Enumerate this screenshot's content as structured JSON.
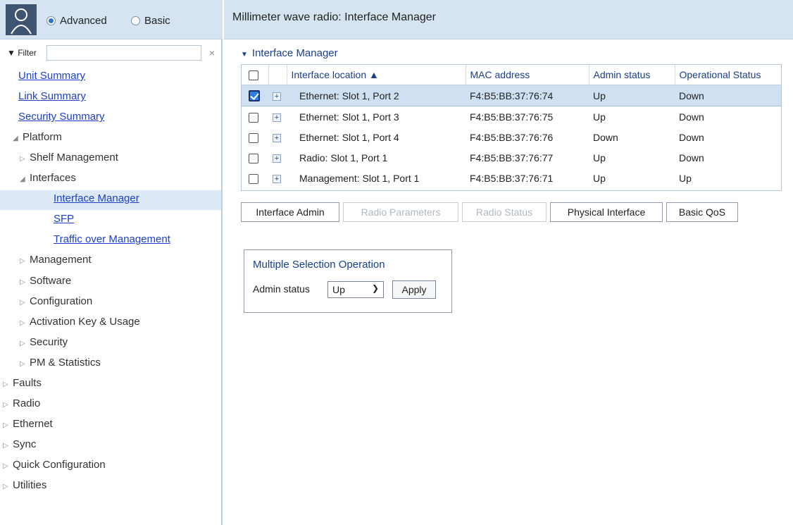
{
  "sidebar": {
    "mode": {
      "advanced_label": "Advanced",
      "basic_label": "Basic",
      "selected": "advanced"
    },
    "filter": {
      "label": "▼ Filter",
      "value": "",
      "clear_icon": "close-icon"
    },
    "items": [
      {
        "label": "Unit Summary",
        "type": "link"
      },
      {
        "label": "Link Summary",
        "type": "link"
      },
      {
        "label": "Security Summary",
        "type": "link"
      },
      {
        "label": "Platform",
        "type": "expanded"
      },
      {
        "label": "Shelf Management",
        "type": "collapsed"
      },
      {
        "label": "Interfaces",
        "type": "expanded"
      },
      {
        "label": "Interface Manager",
        "type": "link",
        "selected": true
      },
      {
        "label": "SFP",
        "type": "link"
      },
      {
        "label": "Traffic over Management",
        "type": "link"
      },
      {
        "label": "Management",
        "type": "collapsed"
      },
      {
        "label": "Software",
        "type": "collapsed"
      },
      {
        "label": "Configuration",
        "type": "collapsed"
      },
      {
        "label": "Activation Key & Usage",
        "type": "collapsed"
      },
      {
        "label": "Security",
        "type": "collapsed"
      },
      {
        "label": "PM & Statistics",
        "type": "collapsed"
      },
      {
        "label": "Faults",
        "type": "collapsed"
      },
      {
        "label": "Radio",
        "type": "collapsed"
      },
      {
        "label": "Ethernet",
        "type": "collapsed"
      },
      {
        "label": "Sync",
        "type": "collapsed"
      },
      {
        "label": "Quick Configuration",
        "type": "collapsed"
      },
      {
        "label": "Utilities",
        "type": "collapsed"
      }
    ]
  },
  "header": {
    "title": "Millimeter wave radio: Interface Manager"
  },
  "main": {
    "section_title": "Interface Manager",
    "table": {
      "columns": [
        "Interface location ▲",
        "MAC address",
        "Admin status",
        "Operational Status"
      ],
      "rows": [
        {
          "checked": true,
          "location": "Ethernet: Slot 1, Port 2",
          "mac": "F4:B5:BB:37:76:74",
          "admin": "Up",
          "oper": "Down"
        },
        {
          "checked": false,
          "location": "Ethernet: Slot 1, Port 3",
          "mac": "F4:B5:BB:37:76:75",
          "admin": "Up",
          "oper": "Down"
        },
        {
          "checked": false,
          "location": "Ethernet: Slot 1, Port 4",
          "mac": "F4:B5:BB:37:76:76",
          "admin": "Down",
          "oper": "Down"
        },
        {
          "checked": false,
          "location": "Radio: Slot 1, Port 1",
          "mac": "F4:B5:BB:37:76:77",
          "admin": "Up",
          "oper": "Down"
        },
        {
          "checked": false,
          "location": "Management: Slot 1, Port 1",
          "mac": "F4:B5:BB:37:76:71",
          "admin": "Up",
          "oper": "Up"
        }
      ]
    },
    "buttons": [
      {
        "label": "Interface Admin",
        "enabled": true
      },
      {
        "label": "Radio Parameters",
        "enabled": false
      },
      {
        "label": "Radio Status",
        "enabled": false
      },
      {
        "label": "Physical Interface",
        "enabled": true
      },
      {
        "label": "Basic QoS",
        "enabled": true
      }
    ],
    "multi_selection": {
      "title": "Multiple Selection Operation",
      "admin_label": "Admin status",
      "admin_value": "Up",
      "apply_label": "Apply"
    }
  },
  "colors": {
    "header_bg": "#d6e4f2",
    "link": "#1e40c8",
    "accent": "#2d7fe0",
    "selected_row": "#cfe0f3"
  }
}
